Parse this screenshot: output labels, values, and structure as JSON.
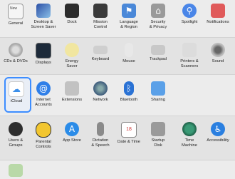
{
  "rows": [
    [
      "General",
      "Desktop &\nScreen Saver",
      "Dock",
      "Mission\nControl",
      "Language\n& Region",
      "Security\n& Privacy",
      "Spotlight",
      "Notifications"
    ],
    [
      "CDs & DVDs",
      "Displays",
      "Energy\nSaver",
      "Keyboard",
      "Mouse",
      "Trackpad",
      "Printers &\nScanners",
      "Sound"
    ],
    [
      "iCloud",
      "Internet\nAccounts",
      "Extensions",
      "Network",
      "Bluetooth",
      "Sharing"
    ],
    [
      "Users &\nGroups",
      "Parental\nControls",
      "App Store",
      "Dictation\n& Speech",
      "Date & Time",
      "Startup\nDisk",
      "Time\nMachine",
      "Accessibility"
    ]
  ],
  "selected": "iCloud",
  "general_badge": "New",
  "date_badge": "18",
  "colors": {
    "accent": "#3d8dff"
  }
}
